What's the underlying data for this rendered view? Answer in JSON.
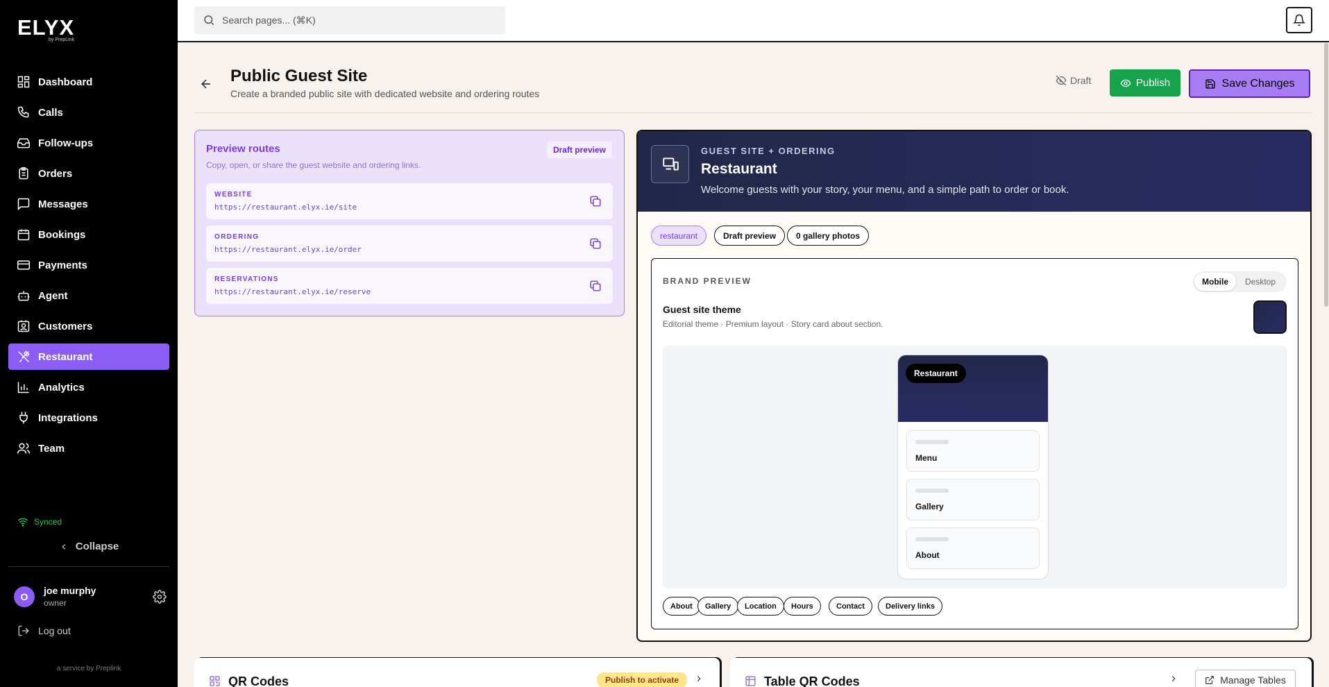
{
  "brand": {
    "logo": "ELYX",
    "logo_sub": "by PrepLink"
  },
  "sidebar": {
    "items": [
      {
        "label": "Dashboard",
        "icon": "dashboard-icon"
      },
      {
        "label": "Calls",
        "icon": "phone-icon"
      },
      {
        "label": "Follow-ups",
        "icon": "inbox-icon"
      },
      {
        "label": "Orders",
        "icon": "clipboard-icon"
      },
      {
        "label": "Messages",
        "icon": "message-icon"
      },
      {
        "label": "Bookings",
        "icon": "calendar-icon"
      },
      {
        "label": "Payments",
        "icon": "credit-card-icon"
      },
      {
        "label": "Agent",
        "icon": "bot-icon"
      },
      {
        "label": "Customers",
        "icon": "contact-icon"
      },
      {
        "label": "Restaurant",
        "icon": "utensils-icon",
        "active": true
      },
      {
        "label": "Analytics",
        "icon": "bar-chart-icon"
      },
      {
        "label": "Integrations",
        "icon": "plug-icon"
      },
      {
        "label": "Team",
        "icon": "users-icon"
      }
    ],
    "synced": "Synced",
    "collapse": "Collapse",
    "user": {
      "initial": "O",
      "name": "joe murphy",
      "role": "owner"
    },
    "logout": "Log out",
    "service": "a service by Preplink"
  },
  "topbar": {
    "search_placeholder": "Search pages... (⌘K)"
  },
  "header": {
    "title": "Public Guest Site",
    "subtitle": "Create a branded public site with dedicated website and ordering routes",
    "draft": "Draft",
    "publish": "Publish",
    "save": "Save Changes"
  },
  "routes": {
    "title": "Preview routes",
    "subtitle": "Copy, open, or share the guest website and ordering links.",
    "badge": "Draft preview",
    "items": [
      {
        "label": "WEBSITE",
        "url": "https://restaurant.elyx.ie/site"
      },
      {
        "label": "ORDERING",
        "url": "https://restaurant.elyx.ie/order"
      },
      {
        "label": "RESERVATIONS",
        "url": "https://restaurant.elyx.ie/reserve"
      }
    ]
  },
  "guest": {
    "eyebrow": "GUEST SITE + ORDERING",
    "title": "Restaurant",
    "desc": "Welcome guests with your story, your menu, and a simple path to order or book.",
    "chips": [
      "restaurant",
      "Draft preview",
      "0 gallery photos"
    ],
    "brand_preview": {
      "label": "BRAND PREVIEW",
      "toggle": [
        "Mobile",
        "Desktop"
      ],
      "theme_title": "Guest site theme",
      "theme_sub": "Editorial theme · Premium layout · Story card about section.",
      "swatch_color": "#25295a",
      "phone_title": "Restaurant",
      "phone_cards": [
        "Menu",
        "Gallery",
        "About"
      ],
      "sections": [
        "About",
        "Gallery",
        "Location",
        "Hours",
        "Contact",
        "Delivery links"
      ]
    }
  },
  "cards": {
    "qr_title": "QR Codes",
    "qr_badge": "Publish to activate",
    "table_qr_title": "Table QR Codes",
    "manage_tables": "Manage Tables"
  },
  "colors": {
    "accent": "#8b5cf6",
    "publish": "#16a34a",
    "navy": "#222748"
  }
}
